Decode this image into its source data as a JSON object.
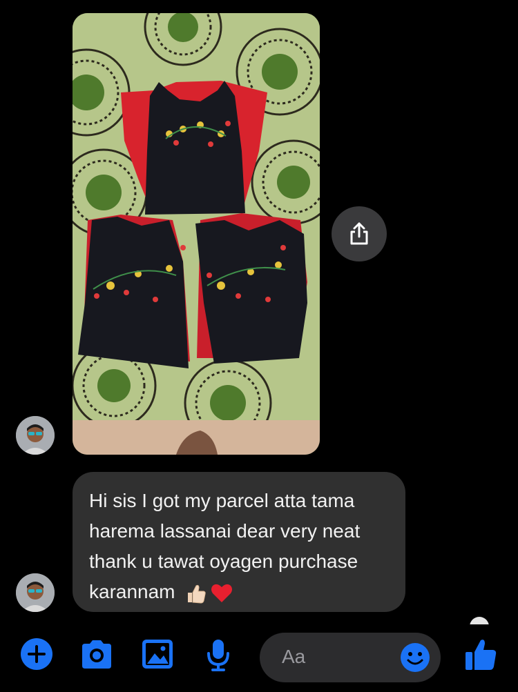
{
  "conversation": {
    "message_text": "Hi sis I got my parcel atta tama\nharema lassanai dear very neat\nthank u tawat oyagen purchase\nkarannam",
    "emojis": [
      "thumbs-up-light-skin",
      "red-heart"
    ],
    "attachment": {
      "kind": "photo",
      "subject": "three black embroidered frocks with red lining on a green printed bedsheet"
    }
  },
  "composer": {
    "placeholder": "Aa",
    "tools": [
      "plus-icon",
      "camera-icon",
      "gallery-icon",
      "microphone-icon",
      "emoji-icon",
      "like-icon"
    ]
  },
  "colors": {
    "accent": "#1a72f5",
    "bubble": "#303030",
    "input": "#2c2c2e",
    "background": "#000000"
  }
}
